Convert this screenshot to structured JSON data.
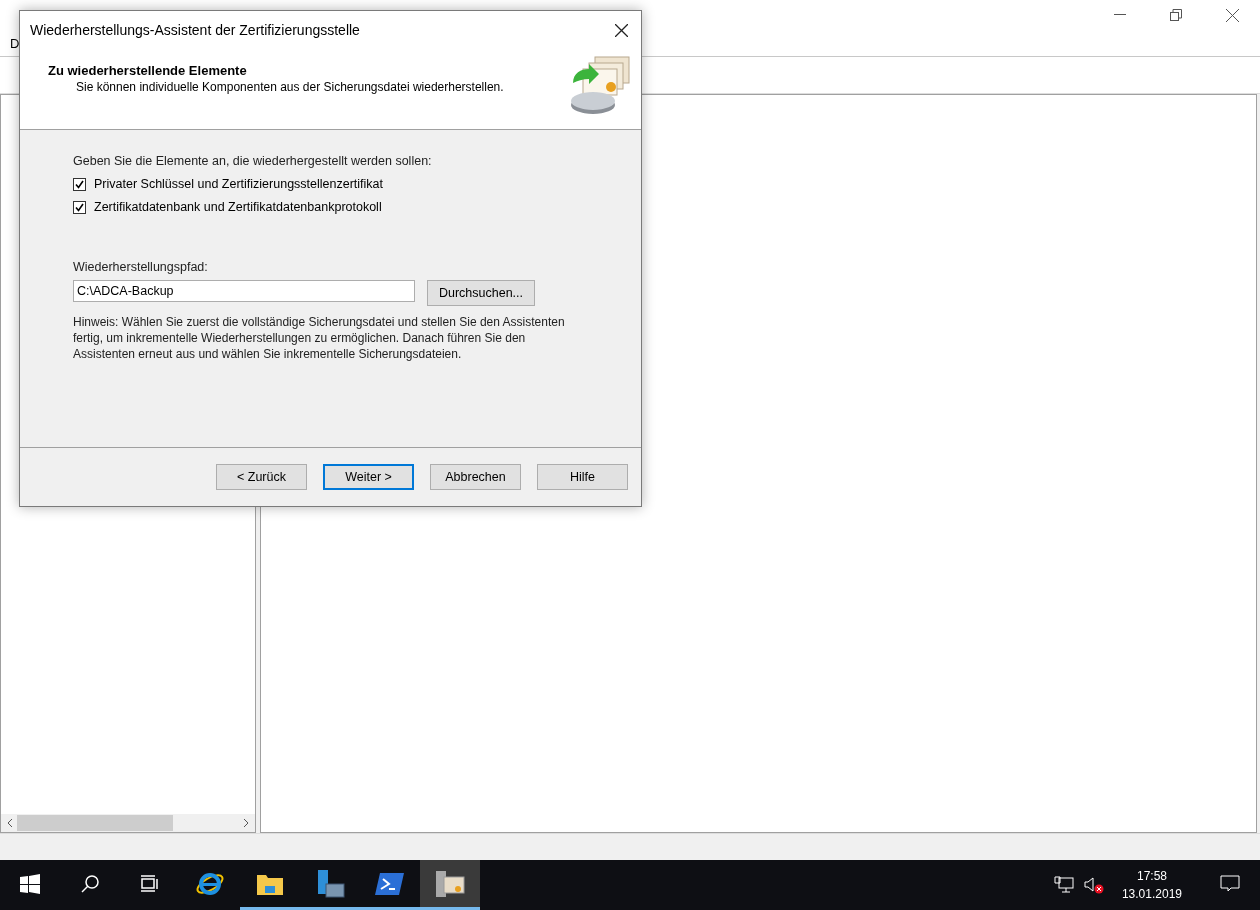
{
  "main_window": {
    "menu": [
      "D"
    ]
  },
  "dialog": {
    "title": "Wiederherstellungs-Assistent der Zertifizierungsstelle",
    "header": {
      "title": "Zu wiederherstellende Elemente",
      "subtitle": "Sie können individuelle Komponenten aus der Sicherungsdatei wiederherstellen."
    },
    "prompt": "Geben Sie die Elemente an, die wiederhergestellt werden sollen:",
    "options": [
      {
        "label": "Privater Schlüssel und Zertifizierungsstellenzertifikat",
        "checked": true
      },
      {
        "label": "Zertifikatdatenbank und Zertifikatdatenbankprotokoll",
        "checked": true
      }
    ],
    "path_label": "Wiederherstellungspfad:",
    "path_value": "C:\\ADCA-Backup",
    "browse_button": "Durchsuchen...",
    "hint": "Hinweis: Wählen Sie zuerst die vollständige Sicherungsdatei und stellen Sie den Assistenten fertig, um inkrementelle Wiederherstellungen zu ermöglichen. Danach führen Sie den Assistenten erneut aus und wählen Sie inkrementelle Sicherungsdateien.",
    "buttons": [
      {
        "label": "< Zurück",
        "default": false
      },
      {
        "label": "Weiter >",
        "default": true
      },
      {
        "label": "Abbrechen",
        "default": false
      },
      {
        "label": "Hilfe",
        "default": false
      }
    ]
  },
  "taskbar": {
    "apps": [
      {
        "kind": "ie",
        "running": false
      },
      {
        "kind": "explorer",
        "running": true
      },
      {
        "kind": "server",
        "running": true
      },
      {
        "kind": "powershell",
        "running": true
      },
      {
        "kind": "certsrv",
        "running": true,
        "selected": true
      }
    ],
    "clock": {
      "time": "17:58",
      "date": "13.01.2019"
    }
  }
}
